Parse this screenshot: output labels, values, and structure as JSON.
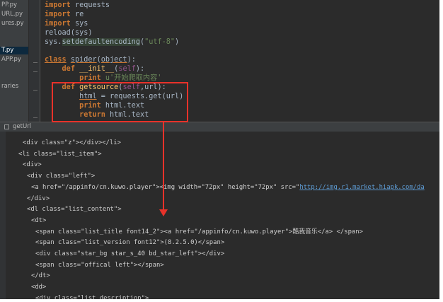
{
  "colors": {
    "background": "#2b2b2b",
    "keyword": "#cc7832",
    "function": "#ffc66d",
    "string": "#6a8759",
    "text": "#a9b7c6",
    "annotation": "#e8322a",
    "link": "#5e9dd6"
  },
  "sidebar": {
    "items": [
      "PP.py",
      "URL.py",
      "ures.py",
      "T.py",
      "APP.py",
      "raries"
    ],
    "selected_index": 3
  },
  "editor": {
    "lines": {
      "l1": {
        "kw": "import",
        "rest": " requests"
      },
      "l2": {
        "kw": "import",
        "rest": " re"
      },
      "l3": {
        "kw": "import",
        "rest": " sys"
      },
      "l4": {
        "text": "reload(sys)"
      },
      "l5": {
        "pre": "sys.",
        "hl": "setdefaultencoding",
        "open": "(",
        "str": "\"utf-8\"",
        "close": ")"
      },
      "l6": {
        "kw": "class",
        "name": "spider",
        "open": "(",
        "base": "object",
        "close": "):"
      },
      "l7": {
        "kw": "def",
        "name": "__init__",
        "open": "(",
        "self": "self",
        "close": "):"
      },
      "l8": {
        "kw": "print",
        "str": " u'开始爬取内容'"
      },
      "l9": {
        "kw": "def",
        "name": "getsource",
        "open": "(",
        "self": "self",
        "rest": ",url):"
      },
      "l10": {
        "pre": "html",
        "rest": " = requests.get(url)"
      },
      "l11": {
        "kw": "print",
        "rest": " html.text"
      },
      "l12": {
        "kw": "return",
        "rest": " html.text"
      }
    }
  },
  "tool_window": {
    "title": "getUrl"
  },
  "output": {
    "o1": "<div class=\"z\"></div></li>",
    "o2": "<li class=\"list_item\">",
    "o3": "<div>",
    "o4": "<div class=\"left\">",
    "o5_pre": "<a href=\"/appinfo/cn.kuwo.player\"><img width=\"72px\" height=\"72px\" src=\"",
    "o5_link": "http://img.r1.market.hiapk.com/da",
    "o6": "</div>",
    "o7": "<dl class=\"list_content\">",
    "o8": "<dt>",
    "o9": "<span class=\"list_title font14_2\"><a href=\"/appinfo/cn.kuwo.player\">酷我音乐</a> </span>",
    "o10": "<span class=\"list_version font12\">(8.2.5.0)</span>",
    "o11": "<div class=\"star_bg star_s_40 bd_star_left\"></div>",
    "o12": "<span class=\"offical left\"></span>",
    "o13": "</dt>",
    "o14": "<dd>",
    "o15": "<div class=\"list_description\">"
  }
}
